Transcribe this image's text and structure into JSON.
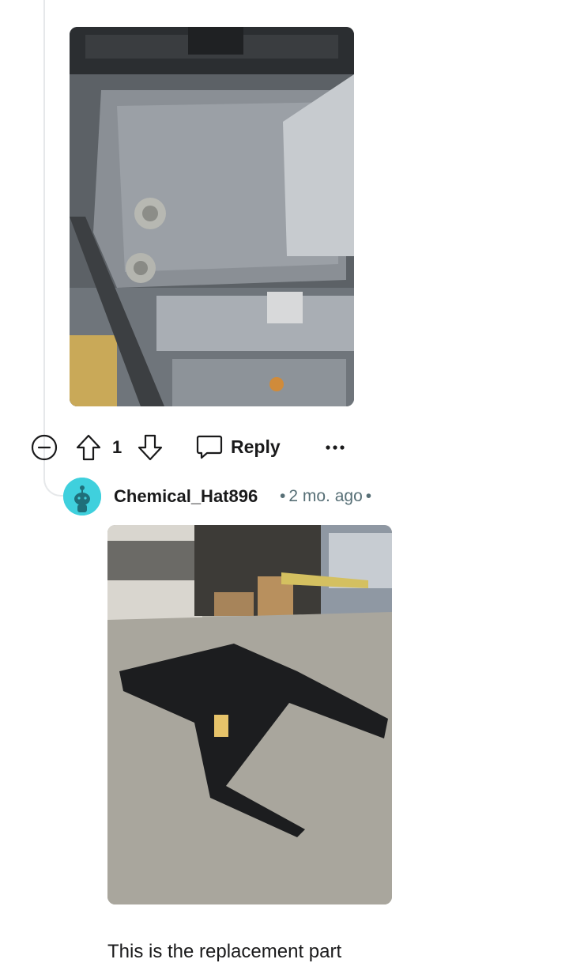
{
  "comment_actions": {
    "collapse_icon": "minus-circle-icon",
    "upvote_icon": "arrow-up-icon",
    "score": "1",
    "downvote_icon": "arrow-down-icon",
    "reply_icon": "speech-bubble-icon",
    "reply_label": "Reply",
    "more_icon": "ellipsis-icon"
  },
  "reply_comment": {
    "username": "Chemical_Hat896",
    "time_ago": "2 mo. ago",
    "avatar_color": "#3fd0dd",
    "text": "This is the replacement part"
  },
  "colors": {
    "text": "#1a1a1b",
    "meta": "#576f76",
    "thread_line": "#e6e8ea"
  }
}
